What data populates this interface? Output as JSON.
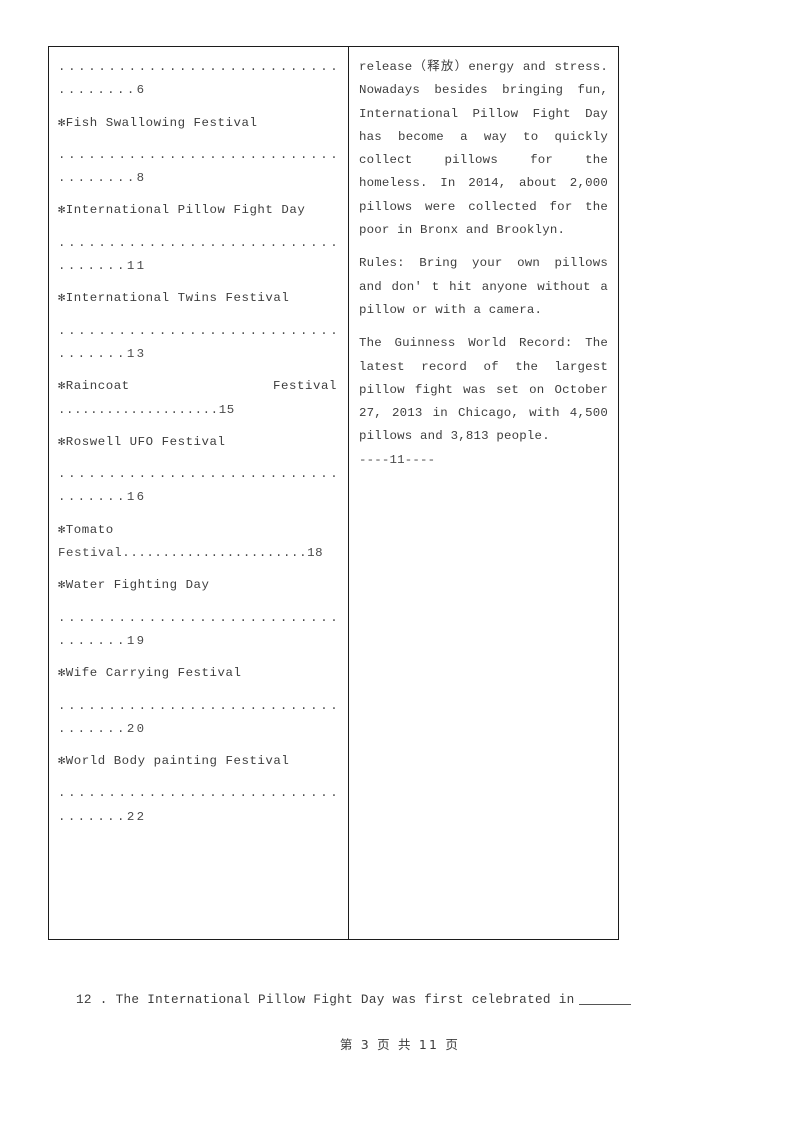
{
  "table": {
    "left_column": {
      "blocks": [
        {
          "type": "leader",
          "spread": "...........................................",
          "tail": "........6"
        },
        {
          "type": "entry",
          "star": "✻",
          "label": "Fish Swallowing Festival"
        },
        {
          "type": "leader",
          "spread": "...........................................",
          "tail": "........8"
        },
        {
          "type": "entry",
          "star": "✻",
          "label": "International Pillow Fight Day"
        },
        {
          "type": "leader",
          "spread": "...........................................",
          "tail": ".......11"
        },
        {
          "type": "entry",
          "star": "✻",
          "label": "International Twins Festival"
        },
        {
          "type": "leader",
          "spread": "...........................................",
          "tail": ".......13"
        },
        {
          "type": "entry_justify",
          "star": "✻",
          "label": "Raincoat",
          "right": "Festival"
        },
        {
          "type": "leader_tight",
          "tail": "....................15"
        },
        {
          "type": "entry",
          "star": "✻",
          "label": "Roswell UFO Festival"
        },
        {
          "type": "leader",
          "spread": "...........................................",
          "tail": ".......16"
        },
        {
          "type": "entry",
          "star": "✻",
          "label": "Tomato"
        },
        {
          "type": "leader_tight",
          "tail": "Festival.......................18"
        },
        {
          "type": "entry",
          "star": "✻",
          "label": "Water Fighting Day"
        },
        {
          "type": "leader",
          "spread": "...........................................",
          "tail": ".......19"
        },
        {
          "type": "entry",
          "star": "✻",
          "label": "Wife Carrying Festival"
        },
        {
          "type": "leader",
          "spread": "...........................................",
          "tail": ".......20"
        },
        {
          "type": "entry",
          "star": "✻",
          "label": "World Body painting Festival"
        },
        {
          "type": "leader",
          "spread": "...........................................",
          "tail": ".......22"
        }
      ]
    },
    "right_column": {
      "paragraphs": [
        "release（释放）energy and stress. Nowadays besides bringing fun, International Pillow Fight Day has become a way to quickly collect pillows for the homeless. In 2014, about 2,000 pillows were collected for the poor in Bronx and Brooklyn.",
        "Rules: Bring your own pillows and don' t hit anyone without a pillow or with a camera.",
        "The Guinness World Record: The latest record of the largest pillow fight was set on October 27, 2013 in Chicago, with 4,500 pillows and 3,813 people."
      ],
      "page_marker": "----11----"
    }
  },
  "question": {
    "number": "12 .",
    "text": "The International Pillow Fight Day was first celebrated in"
  },
  "footer": {
    "text": "第 3 页 共 11 页"
  }
}
